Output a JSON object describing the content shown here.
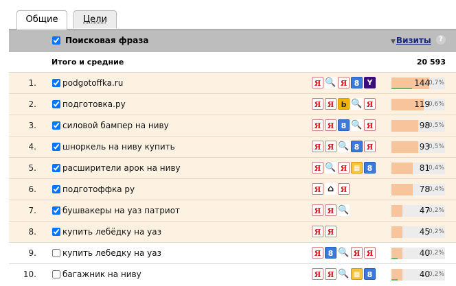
{
  "tabs": [
    {
      "label": "Общие",
      "active": true
    },
    {
      "label": "Цели",
      "active": false
    }
  ],
  "header": {
    "phrase_label": "Поисковая фраза",
    "visits_label": "Визиты",
    "sort_arrow": "▼",
    "help": "?"
  },
  "totals": {
    "label": "Итого и средние",
    "value": "20 593"
  },
  "colors": {
    "bar_fill": "#f8c49b",
    "bar_bg": "#ececec",
    "selected_row": "#fdf2e2",
    "header_bg": "#bdbdbd"
  },
  "rows": [
    {
      "num": "1.",
      "phrase": "podgotoffka.ru",
      "checked": true,
      "engines": [
        "yandex",
        "search",
        "yandex",
        "google",
        "yahoo"
      ],
      "visits": "144",
      "percent": "0,7%",
      "share": 0.7,
      "green": true
    },
    {
      "num": "2.",
      "phrase": "подготовка.ру",
      "checked": true,
      "engines": [
        "yandex",
        "yandex",
        "bing",
        "search",
        "yandex"
      ],
      "visits": "119",
      "percent": "0,6%",
      "share": 0.6,
      "green": false
    },
    {
      "num": "3.",
      "phrase": "силовой бампер на ниву",
      "checked": true,
      "engines": [
        "yandex",
        "yandex",
        "google",
        "search",
        "yandex"
      ],
      "visits": "98",
      "percent": "0,5%",
      "share": 0.5,
      "green": false
    },
    {
      "num": "4.",
      "phrase": "шноркель на ниву купить",
      "checked": true,
      "engines": [
        "yandex",
        "yandex",
        "search",
        "google",
        "yandex"
      ],
      "visits": "93",
      "percent": "0,5%",
      "share": 0.5,
      "green": false
    },
    {
      "num": "5.",
      "phrase": "расширители арок на ниву",
      "checked": true,
      "engines": [
        "yandex",
        "search",
        "yandex",
        "directory",
        "google"
      ],
      "visits": "81",
      "percent": "0,4%",
      "share": 0.4,
      "green": false
    },
    {
      "num": "6.",
      "phrase": "подготоффка ру",
      "checked": true,
      "engines": [
        "yandex",
        "home",
        "yandex"
      ],
      "visits": "78",
      "percent": "0,4%",
      "share": 0.4,
      "green": false
    },
    {
      "num": "7.",
      "phrase": "бушвакеры на уаз патриот",
      "checked": true,
      "engines": [
        "yandex",
        "yandex",
        "search"
      ],
      "visits": "47",
      "percent": "0,2%",
      "share": 0.2,
      "green": false
    },
    {
      "num": "8.",
      "phrase": "купить лебёдку на уаз",
      "checked": true,
      "engines": [
        "yandex",
        "yandex"
      ],
      "visits": "45",
      "percent": "0,2%",
      "share": 0.2,
      "green": false
    },
    {
      "num": "9.",
      "phrase": "купить лебедку на уаз",
      "checked": false,
      "engines": [
        "yandex",
        "google",
        "search",
        "yandex",
        "yandex"
      ],
      "visits": "40",
      "percent": "0,2%",
      "share": 0.2,
      "green": true
    },
    {
      "num": "10.",
      "phrase": "багажник на ниву",
      "checked": false,
      "engines": [
        "yandex",
        "yandex",
        "search",
        "directory",
        "google"
      ],
      "visits": "40",
      "percent": "0,2%",
      "share": 0.2,
      "green": true
    }
  ]
}
